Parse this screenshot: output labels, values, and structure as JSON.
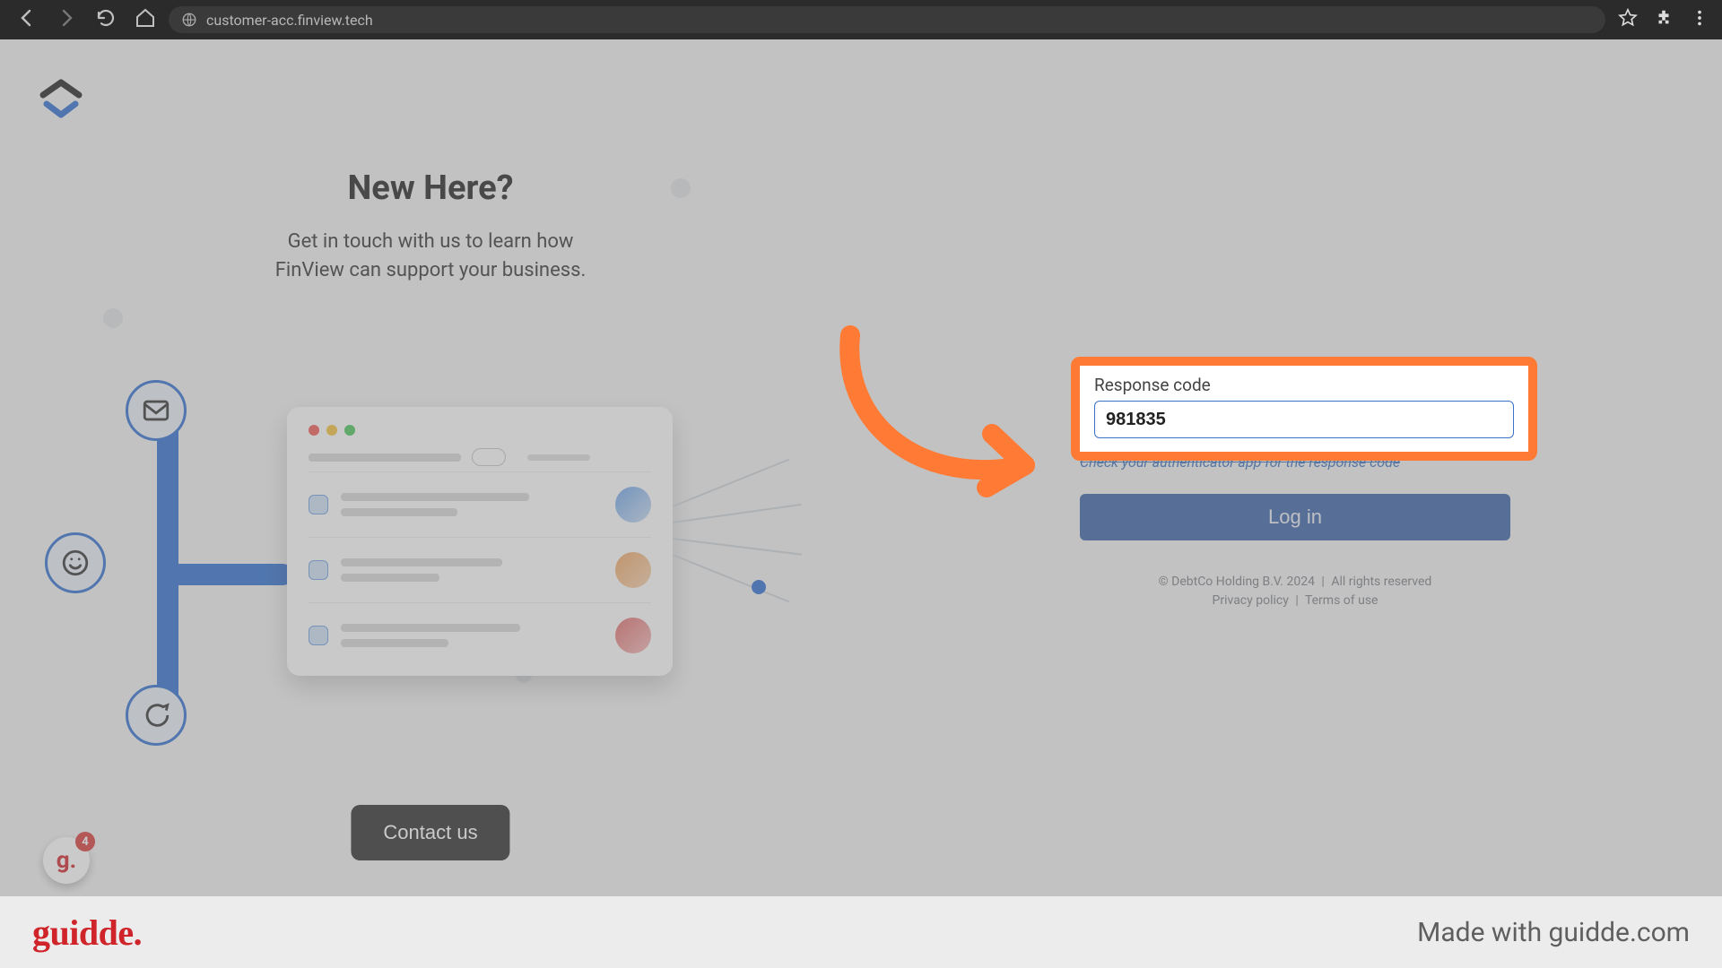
{
  "browser": {
    "url": "customer-acc.finview.tech"
  },
  "left": {
    "heading": "New Here?",
    "sub_line1": "Get in touch with us to learn how",
    "sub_line2": "FinView can support your business.",
    "contact_label": "Contact us"
  },
  "widget": {
    "badge_count": "4"
  },
  "form": {
    "label": "Response code",
    "value": "981835",
    "helper": "Check your authenticator app for the response code",
    "login_label": "Log in"
  },
  "legal": {
    "copyright": "© DebtCo Holding B.V. 2024",
    "rights": "All rights reserved",
    "privacy": "Privacy policy",
    "terms": "Terms of use"
  },
  "footer": {
    "brand": "guidde.",
    "made_with": "Made with guidde.com"
  }
}
